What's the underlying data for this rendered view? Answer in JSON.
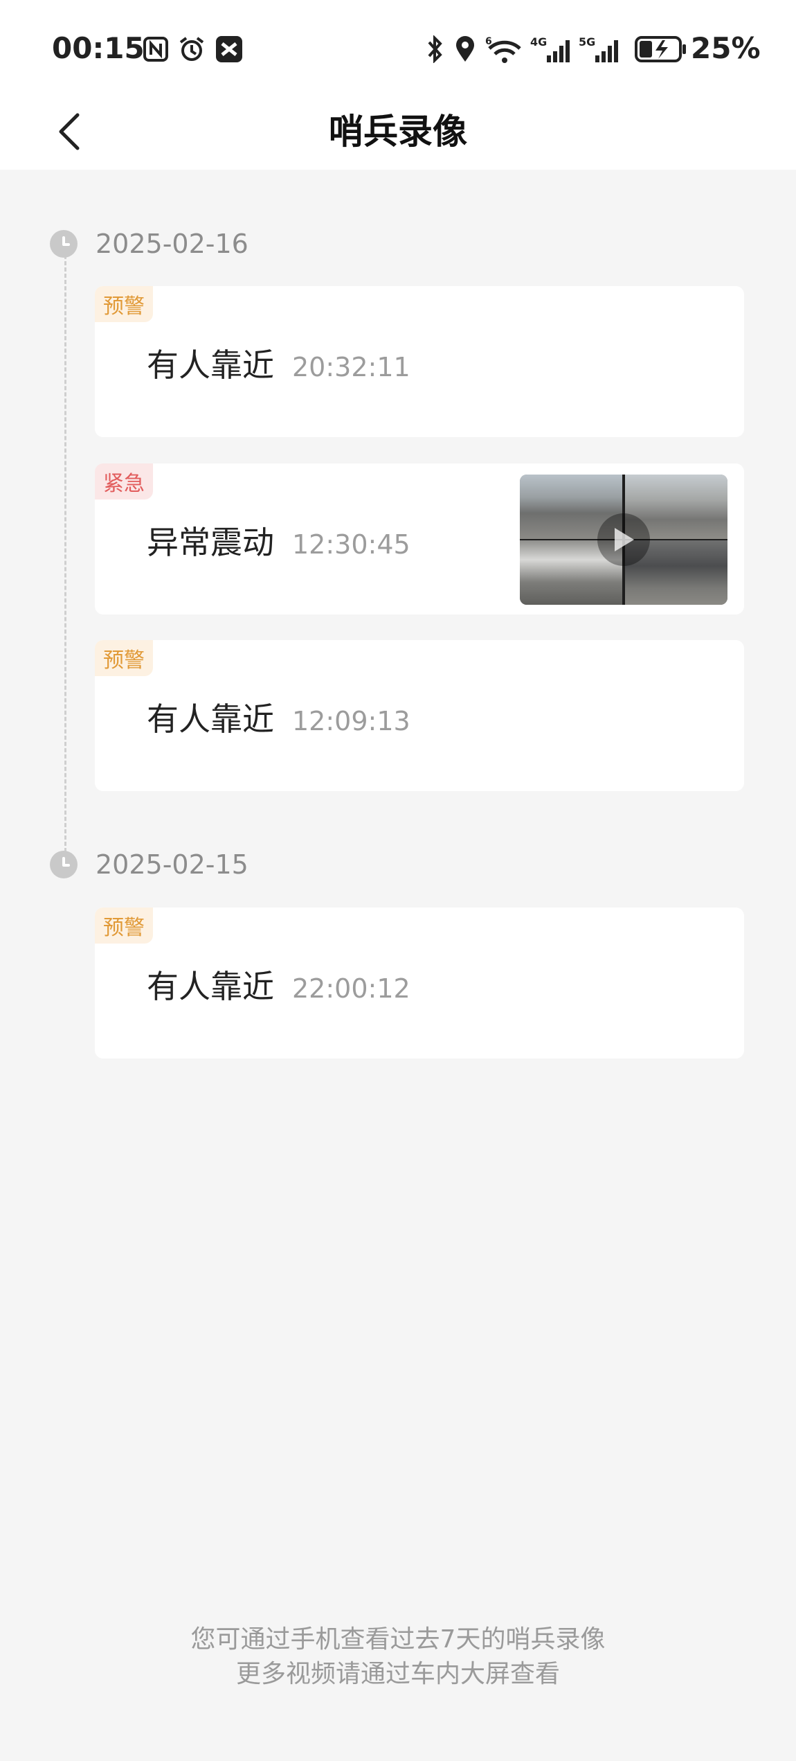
{
  "status_bar": {
    "time": "00:15",
    "battery_percent": "25%",
    "network_labels": [
      "6",
      "4G",
      "5G"
    ]
  },
  "header": {
    "title": "哨兵录像"
  },
  "groups": [
    {
      "date": "2025-02-16",
      "events": [
        {
          "tag": "预警",
          "level": "warn",
          "name": "有人靠近",
          "time": "20:32:11"
        },
        {
          "tag": "紧急",
          "level": "urgent",
          "name": "异常震动",
          "time": "12:30:45",
          "has_thumbnail": true
        },
        {
          "tag": "预警",
          "level": "warn",
          "name": "有人靠近",
          "time": "12:09:13"
        }
      ]
    },
    {
      "date": "2025-02-15",
      "events": [
        {
          "tag": "预警",
          "level": "warn",
          "name": "有人靠近",
          "time": "22:00:12"
        }
      ]
    }
  ],
  "footer": {
    "line1": "您可通过手机查看过去7天的哨兵录像",
    "line2": "更多视频请通过车内大屏查看"
  },
  "colors": {
    "warn_tag_bg": "#fdf1e2",
    "warn_tag_text": "#e19a38",
    "urgent_tag_bg": "#fbe7e7",
    "urgent_tag_text": "#e25c5c",
    "page_bg": "#f5f5f5"
  }
}
